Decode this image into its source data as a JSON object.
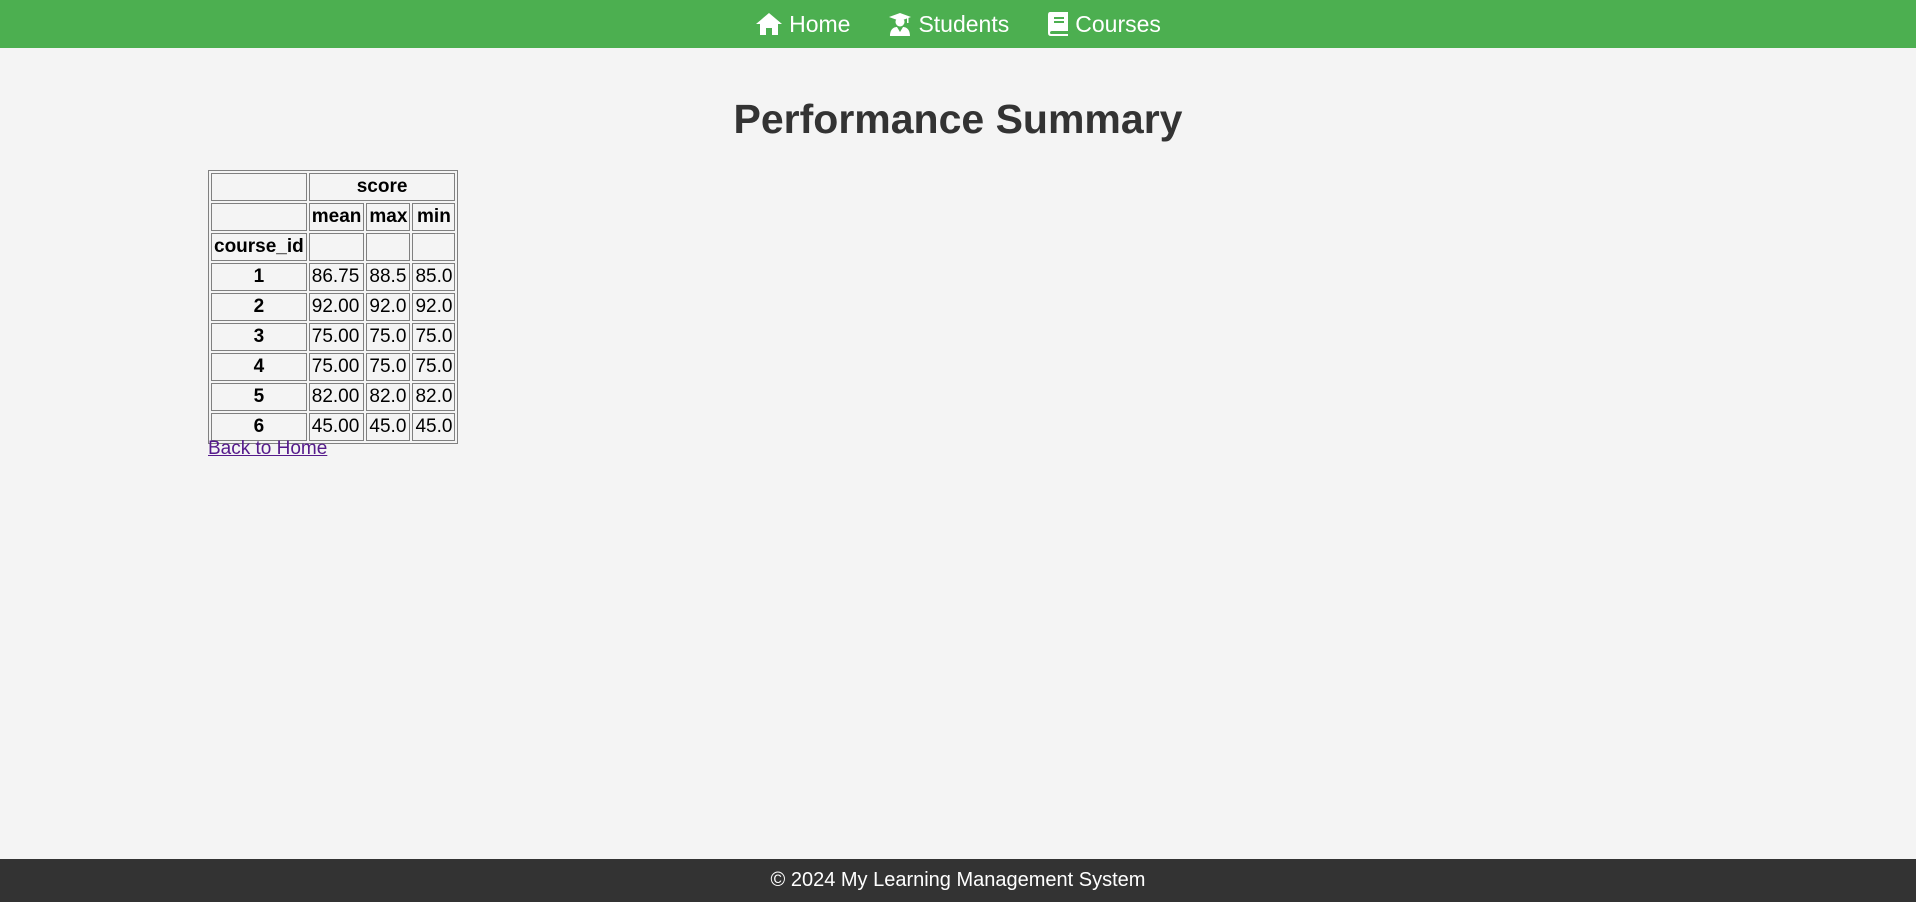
{
  "nav": {
    "items": [
      {
        "label": "Home",
        "icon": "home-icon"
      },
      {
        "label": "Students",
        "icon": "graduate-icon"
      },
      {
        "label": "Courses",
        "icon": "book-icon"
      }
    ]
  },
  "page": {
    "title": "Performance Summary",
    "back_link": "Back to Home"
  },
  "table": {
    "group_header": "score",
    "sub_headers": [
      "mean",
      "max",
      "min"
    ],
    "index_name": "course_id",
    "rows": [
      {
        "id": "1",
        "mean": "86.75",
        "max": "88.5",
        "min": "85.0"
      },
      {
        "id": "2",
        "mean": "92.00",
        "max": "92.0",
        "min": "92.0"
      },
      {
        "id": "3",
        "mean": "75.00",
        "max": "75.0",
        "min": "75.0"
      },
      {
        "id": "4",
        "mean": "75.00",
        "max": "75.0",
        "min": "75.0"
      },
      {
        "id": "5",
        "mean": "82.00",
        "max": "82.0",
        "min": "82.0"
      },
      {
        "id": "6",
        "mean": "45.00",
        "max": "45.0",
        "min": "45.0"
      }
    ]
  },
  "footer": {
    "text": "© 2024 My Learning Management System"
  },
  "colors": {
    "nav_bg": "#4caf50",
    "footer_bg": "#333333",
    "page_bg": "#f4f4f4",
    "visited_link": "#551a8b"
  }
}
